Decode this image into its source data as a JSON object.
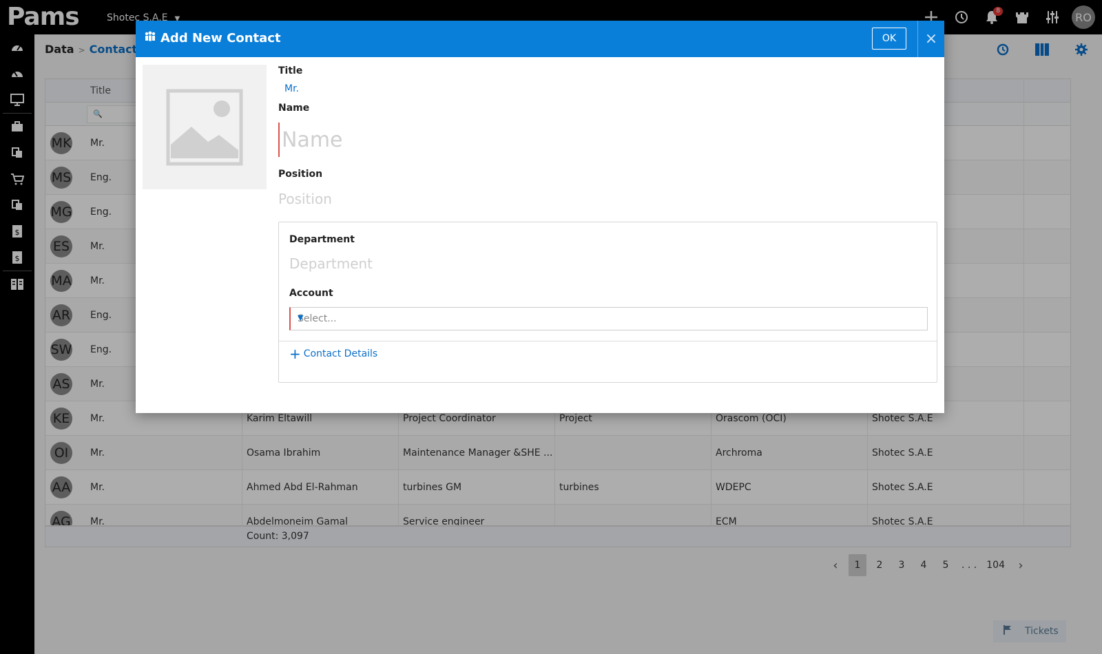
{
  "app": {
    "logo": "Pams",
    "company": "Shotec S.A.E",
    "notification_count": "8",
    "user_initials": "RO"
  },
  "breadcrumb": {
    "root": "Data",
    "current": "Contacts"
  },
  "grid": {
    "header": {
      "title_col": "Title"
    },
    "rows": [
      {
        "initials": "MK",
        "title": "Mr.",
        "name": "",
        "position": "",
        "department": "",
        "account": "",
        "company": ""
      },
      {
        "initials": "MS",
        "title": "Eng.",
        "name": "",
        "position": "",
        "department": "",
        "account": "",
        "company": ""
      },
      {
        "initials": "MG",
        "title": "Eng.",
        "name": "",
        "position": "",
        "department": "",
        "account": "",
        "company": ""
      },
      {
        "initials": "ES",
        "title": "Mr.",
        "name": "",
        "position": "",
        "department": "",
        "account": "",
        "company": ""
      },
      {
        "initials": "MA",
        "title": "Mr.",
        "name": "",
        "position": "",
        "department": "",
        "account": "",
        "company": ""
      },
      {
        "initials": "AR",
        "title": "Eng.",
        "name": "",
        "position": "",
        "department": "",
        "account": "",
        "company": ""
      },
      {
        "initials": "SW",
        "title": "Eng.",
        "name": "",
        "position": "",
        "department": "",
        "account": "",
        "company": ""
      },
      {
        "initials": "AS",
        "title": "Mr.",
        "name": "",
        "position": "",
        "department": "",
        "account": "",
        "company": ""
      },
      {
        "initials": "KE",
        "title": "Mr.",
        "name": "Karim Eltawill",
        "position": "Project Coordinator",
        "department": "Project",
        "account": "Orascom (OCI)",
        "company": "Shotec S.A.E"
      },
      {
        "initials": "OI",
        "title": "Mr.",
        "name": "Osama Ibrahim",
        "position": "Maintenance Manager &SHE ...",
        "department": "",
        "account": "Archroma",
        "company": "Shotec S.A.E"
      },
      {
        "initials": "AA",
        "title": "Mr.",
        "name": "Ahmed Abd El-Rahman",
        "position": "turbines GM",
        "department": "turbines",
        "account": "WDEPC",
        "company": "Shotec S.A.E"
      },
      {
        "initials": "AG",
        "title": "Mr.",
        "name": "Abdelmoneim Gamal",
        "position": "Service engineer",
        "department": "",
        "account": "ECM",
        "company": "Shotec S.A.E"
      }
    ],
    "count": "Count: 3,097"
  },
  "pager": {
    "pages": [
      "1",
      "2",
      "3",
      "4",
      "5"
    ],
    "ellipsis": ". . .",
    "last": "104"
  },
  "tickets": {
    "label": "Tickets"
  },
  "modal": {
    "title": "Add New Contact",
    "ok_label": "OK",
    "close_label": "×",
    "title_label": "Title",
    "title_value": "Mr.",
    "name_label": "Name",
    "name_placeholder": "Name",
    "position_label": "Position",
    "position_placeholder": "Position",
    "department_label": "Department",
    "department_placeholder": "Department",
    "account_label": "Account",
    "account_placeholder": "Select...",
    "contact_details_label": "Contact Details"
  },
  "colors": {
    "header_blue": "#0a7fd9",
    "link_blue": "#0a6fc9",
    "required_red": "#d9534f"
  }
}
